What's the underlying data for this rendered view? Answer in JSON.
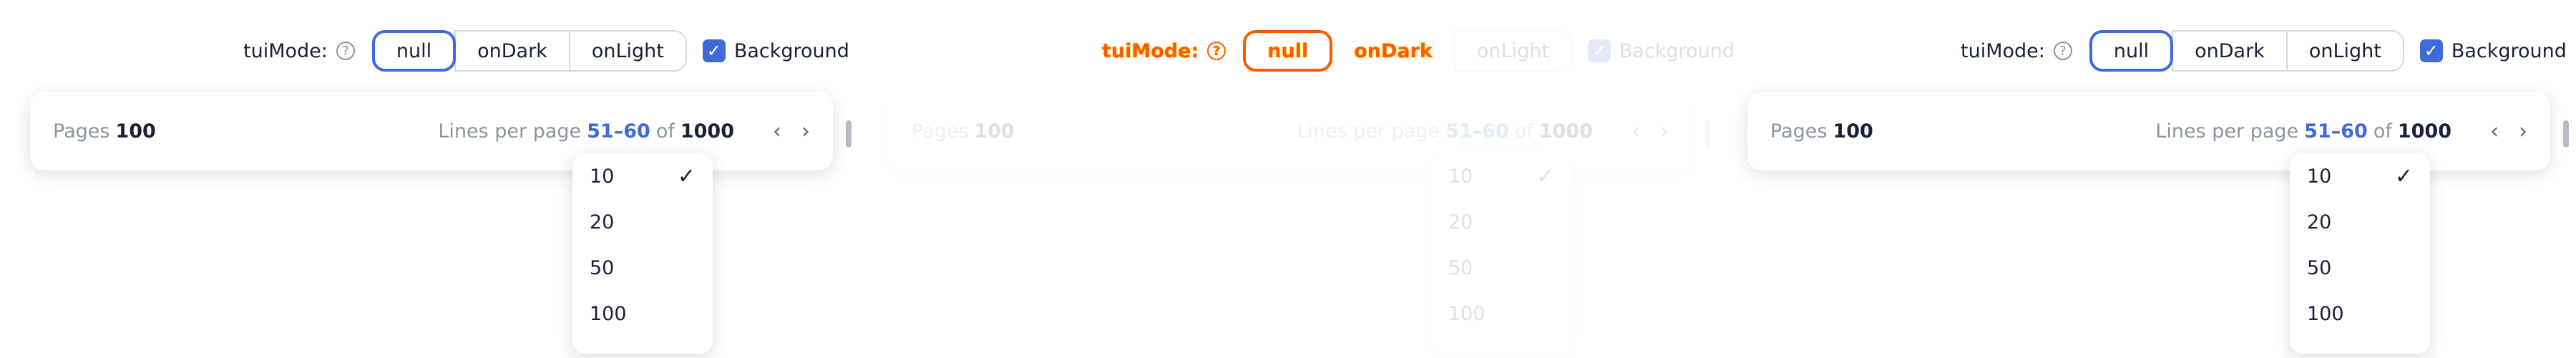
{
  "mode_bar": {
    "label": "tuiMode:",
    "help_icon": "help-circle-icon",
    "options": [
      "null",
      "onDark",
      "onLight"
    ],
    "selected": "null",
    "background_label": "Background",
    "background_checked": true
  },
  "pagination": {
    "pages_label": "Pages",
    "pages_count": "100",
    "lines_label": "Lines per page",
    "range": "51–60",
    "of_label": "of",
    "total": "1000",
    "prev_icon": "chevron-left-icon",
    "next_icon": "chevron-right-icon"
  },
  "dropdown": {
    "options": [
      "10",
      "20",
      "50",
      "100"
    ],
    "selected": "10",
    "check_icon": "check-icon"
  },
  "colors": {
    "accent": "#3f6bd8",
    "text": "#1b1f3b",
    "muted": "#8d93a3",
    "glitch": "#ff5a00"
  }
}
